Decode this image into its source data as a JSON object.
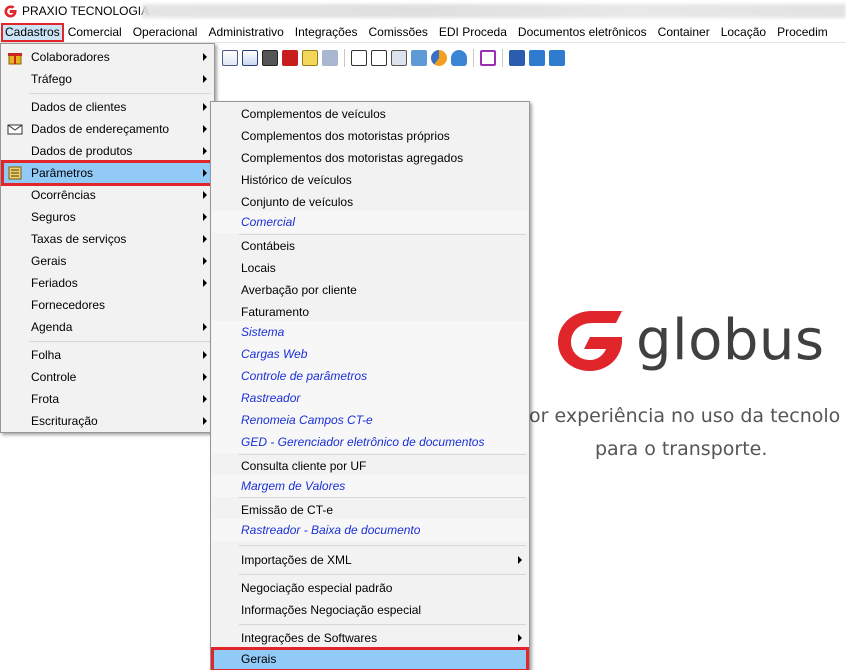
{
  "window": {
    "title": "PRAXIO TECNOLOGIA"
  },
  "menubar": {
    "items": [
      "Cadastros",
      "Comercial",
      "Operacional",
      "Administrativo",
      "Integrações",
      "Comissões",
      "EDI Proceda",
      "Documentos eletrônicos",
      "Container",
      "Locação",
      "Procedim"
    ]
  },
  "cadastros_menu": {
    "items": [
      {
        "label": "Colaboradores",
        "submenu": true,
        "icon": "gift-icon"
      },
      {
        "label": "Tráfego",
        "submenu": true
      },
      {
        "label": "Dados de clientes",
        "submenu": true
      },
      {
        "label": "Dados de endereçamento",
        "submenu": true,
        "icon": "envelope-icon"
      },
      {
        "label": "Dados de produtos",
        "submenu": true
      },
      {
        "label": "Parâmetros",
        "submenu": true,
        "icon": "settings-icon",
        "selected": true
      },
      {
        "label": "Ocorrências",
        "submenu": true
      },
      {
        "label": "Seguros",
        "submenu": true
      },
      {
        "label": "Taxas de serviços",
        "submenu": true
      },
      {
        "label": "Gerais",
        "submenu": true
      },
      {
        "label": "Feriados",
        "submenu": true
      },
      {
        "label": "Fornecedores",
        "submenu": false
      },
      {
        "label": "Agenda",
        "submenu": true
      },
      {
        "label": "Folha",
        "submenu": true
      },
      {
        "label": "Controle",
        "submenu": true
      },
      {
        "label": "Frota",
        "submenu": true
      },
      {
        "label": "Escrituração",
        "submenu": true
      }
    ]
  },
  "parametros_menu": {
    "items": [
      {
        "label": "Complementos de veículos"
      },
      {
        "label": "Complementos dos motoristas próprios"
      },
      {
        "label": "Complementos dos motoristas agregados"
      },
      {
        "label": "Histórico de veículos"
      },
      {
        "label": "Conjunto de veículos"
      },
      {
        "label": "Comercial",
        "italic": true
      },
      {
        "label": "Contábeis"
      },
      {
        "label": "Locais"
      },
      {
        "label": "Averbação por cliente"
      },
      {
        "label": "Faturamento"
      },
      {
        "label": "Sistema",
        "italic": true
      },
      {
        "label": "Cargas Web",
        "italic": true
      },
      {
        "label": "Controle de parâmetros",
        "italic": true
      },
      {
        "label": "Rastreador",
        "italic": true
      },
      {
        "label": "Renomeia Campos CT-e",
        "italic": true
      },
      {
        "label": "GED - Gerenciador eletrônico de documentos",
        "italic": true
      },
      {
        "label": "Consulta cliente por UF"
      },
      {
        "label": "Margem de Valores",
        "italic": true
      },
      {
        "label": "Emissão de CT-e"
      },
      {
        "label": "Rastreador - Baixa de documento",
        "italic": true
      },
      {
        "label": "Importações de XML",
        "submenu": true
      },
      {
        "label": "Negociação especial padrão"
      },
      {
        "label": "Informações Negociação especial"
      },
      {
        "label": "Integrações de Softwares",
        "submenu": true
      },
      {
        "label": "Gerais",
        "selected": true
      }
    ]
  },
  "background": {
    "brand_name": "globus",
    "tagline_line1": "or experiência no uso da tecnolo",
    "tagline_line2": "para o transporte.",
    "brand_color": "#e0252b"
  },
  "toolbar_icons": [
    "document-icon",
    "copy-icon",
    "printer-icon",
    "pin-icon",
    "clipboard-icon",
    "tools-icon",
    "preview-icon",
    "report-icon",
    "filter-icon",
    "print-icon",
    "chart-icon",
    "bell-icon",
    "monitor-icon",
    "wrench-icon",
    "globus-icon",
    "file-icon"
  ]
}
